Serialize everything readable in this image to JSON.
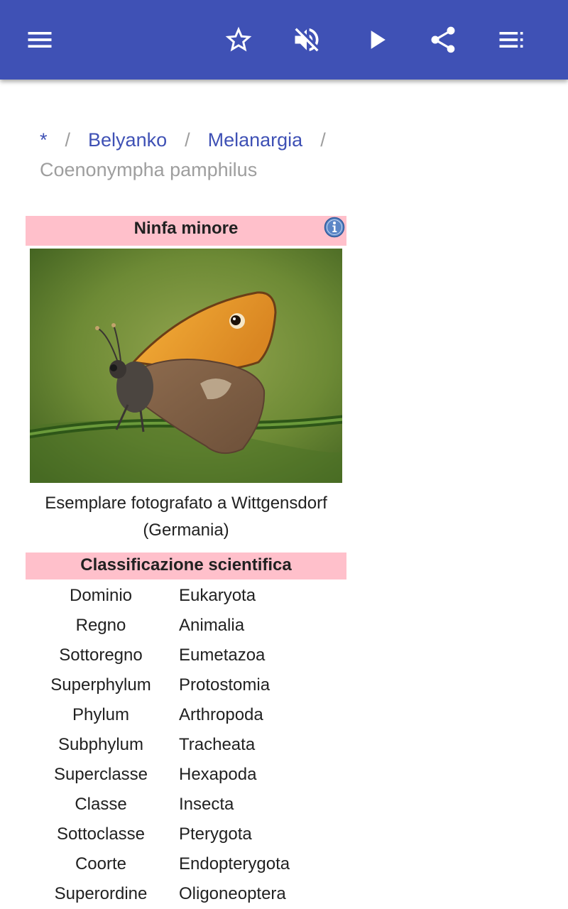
{
  "toolbar": {
    "icons": [
      "menu-icon",
      "star-outline-icon",
      "volume-off-icon",
      "play-icon",
      "share-icon",
      "playlist-icon"
    ],
    "color": "#3f51b5"
  },
  "breadcrumb": {
    "home": "*",
    "link1": "Belyanko",
    "link2": "Melanargia",
    "separator": "/",
    "current": "Coenonympha pamphilus"
  },
  "infobox": {
    "title": "Ninfa minore",
    "caption": "Esemplare fotografato a Wittgensdorf (Germania)",
    "classification_heading": "Classificazione scientifica",
    "rows": [
      {
        "rank": "Dominio",
        "taxon": "Eukaryota"
      },
      {
        "rank": "Regno",
        "taxon": "Animalia"
      },
      {
        "rank": "Sottoregno",
        "taxon": "Eumetazoa"
      },
      {
        "rank": "Superphylum",
        "taxon": "Protostomia"
      },
      {
        "rank": "Phylum",
        "taxon": "Arthropoda"
      },
      {
        "rank": "Subphylum",
        "taxon": "Tracheata"
      },
      {
        "rank": "Superclasse",
        "taxon": "Hexapoda"
      },
      {
        "rank": "Classe",
        "taxon": "Insecta"
      },
      {
        "rank": "Sottoclasse",
        "taxon": "Pterygota"
      },
      {
        "rank": "Coorte",
        "taxon": "Endopterygota"
      },
      {
        "rank": "Superordine",
        "taxon": "Oligoneoptera"
      }
    ],
    "header_color": "#ffc0cb"
  }
}
